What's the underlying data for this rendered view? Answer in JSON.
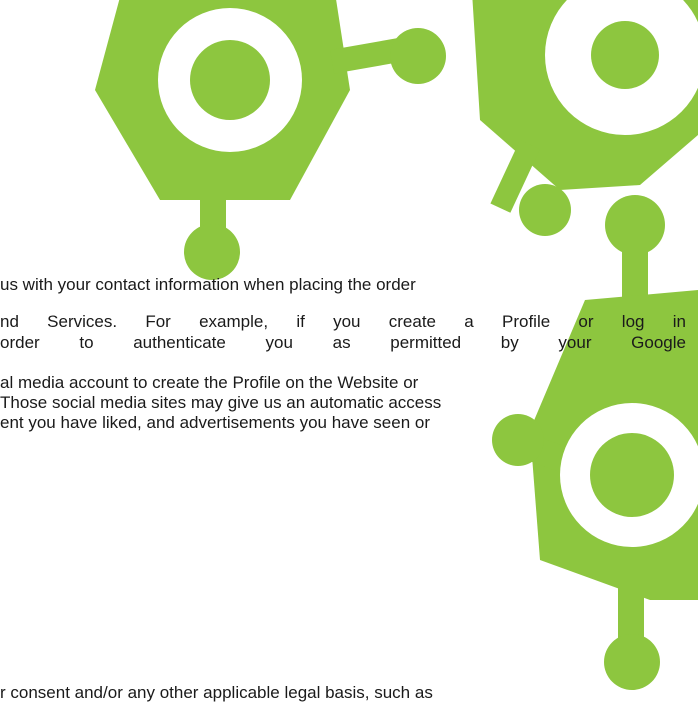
{
  "document": {
    "lines": [
      " us with your contact information when placing the order",
      "nd Services. For example, if you create a Profile or log in",
      "order to authenticate you as permitted by your Google",
      "al media account to create the Profile on the Website or",
      "Those social media sites may give us an automatic access",
      "ent you have liked, and advertisements you have seen or",
      "r consent and/or any other applicable legal basis, such as"
    ]
  },
  "colors": {
    "graphic": "#8dc63f",
    "text": "#1a1a1a"
  }
}
